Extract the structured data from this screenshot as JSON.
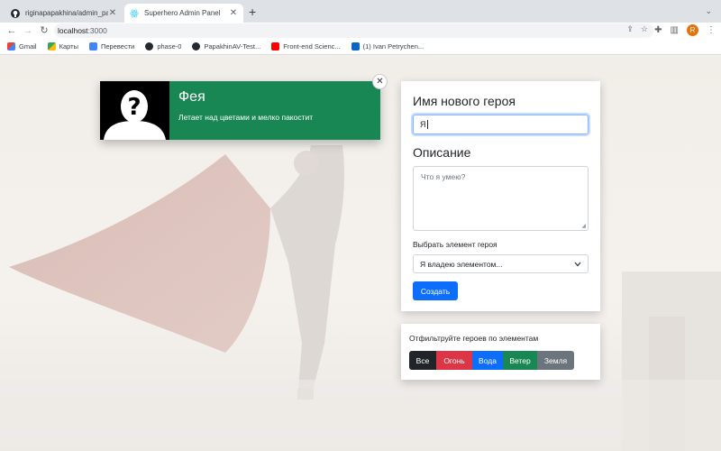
{
  "browser": {
    "tabs": [
      {
        "title": "riginapapakhina/admin_panel",
        "active": false
      },
      {
        "title": "Superhero Admin Panel",
        "active": true
      }
    ],
    "address": {
      "host": "localhost",
      "port": ":3000"
    },
    "profile_initial": "R",
    "bookmarks": [
      {
        "label": "Gmail",
        "icon": "gmail-icon"
      },
      {
        "label": "Карты",
        "icon": "maps-icon"
      },
      {
        "label": "Перевести",
        "icon": "translate-icon"
      },
      {
        "label": "phase-0",
        "icon": "github-icon"
      },
      {
        "label": "PapakhinAV-Test...",
        "icon": "github-icon"
      },
      {
        "label": "Front-end Scienc...",
        "icon": "youtube-icon"
      },
      {
        "label": "(1) Ivan Petrychen...",
        "icon": "linkedin-icon"
      }
    ]
  },
  "hero_card": {
    "name": "Фея",
    "description": "Летает над цветами и мелко пакостит",
    "color": "#198754"
  },
  "form": {
    "name_label": "Имя нового героя",
    "name_value": "Я",
    "description_label": "Описание",
    "description_placeholder": "Что я умею?",
    "element_label": "Выбрать элемент героя",
    "element_selected": "Я владею элементом...",
    "submit_label": "Создать"
  },
  "filter": {
    "title": "Отфильтруйте героев по элементам",
    "buttons": [
      {
        "label": "Все",
        "color": "#212529"
      },
      {
        "label": "Огонь",
        "color": "#dc3545"
      },
      {
        "label": "Вода",
        "color": "#0d6efd"
      },
      {
        "label": "Ветер",
        "color": "#198754"
      },
      {
        "label": "Земля",
        "color": "#6c757d"
      }
    ]
  }
}
